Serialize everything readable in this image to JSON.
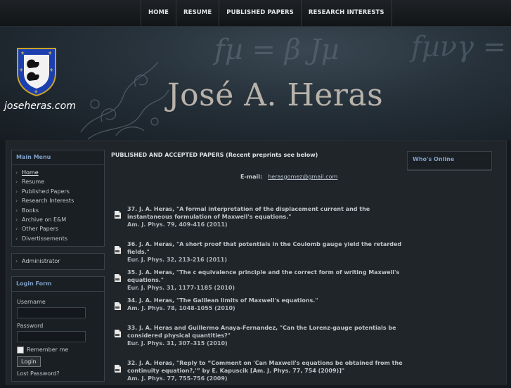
{
  "nav": [
    "HOME",
    "RESUME",
    "PUBLISHED PAPERS",
    "RESEARCH INTERESTS"
  ],
  "header": {
    "equation1": "fµ = β Jµ",
    "equation2": "fµνγ = 0",
    "title": "José A. Heras",
    "site_name": "joseheras.com"
  },
  "main_menu": {
    "title": "Main Menu",
    "items": [
      "Home",
      "Resume",
      "Published Papers",
      "Research Interests",
      "Books",
      "Archive on E&M",
      "Other Papers",
      "Divertissements"
    ]
  },
  "admin_menu": {
    "items": [
      "Administrator"
    ]
  },
  "login": {
    "title": "Login Form",
    "username_label": "Username",
    "password_label": "Password",
    "remember_label": "Remember me",
    "login_button": "Login",
    "lost_password": "Lost Password?"
  },
  "whos_online": {
    "title": "Who's Online"
  },
  "content": {
    "heading": "PUBLISHED AND ACCEPTED PAPERS (Recent preprints see below)",
    "email_label": "E-mail:",
    "email": "herasgomez@gmail.com",
    "papers": [
      {
        "text": "37. J. A. Heras, \"A formal interpretation of the displacement current and the instantaneous formulation of Maxwell's equations.\"",
        "ref": "Am. J. Phys. 79, 409-416 (2011)"
      },
      {
        "text": "36. J. A. Heras, \"A short proof that potentials in the Coulomb gauge yield the retarded fields.\"",
        "ref": "Eur. J. Phys. 32, 213-216 (2011)"
      },
      {
        "text": "35. J. A. Heras, \"The c equivalence principle and the correct form of writing Maxwell's equations.\"",
        "ref": "Eur. J. Phys. 31, 1177-1185 (2010)"
      },
      {
        "text": "34. J. A. Heras, \"The Galilean limits of Maxwell's equations.\"",
        "ref": "Am. J. Phys. 78, 1048-1055 (2010)"
      },
      {
        "text": "33. J. A. Heras and Guillermo Anaya-Fernandez, \"Can the Lorenz-gauge potentials be considered physical quantities?\"",
        "ref": "Eur. J. Phys. 31, 307–315 (2010)"
      },
      {
        "text": "32. J. A. Heras, \"Reply to “Comment on 'Can Maxwell's equations be obtained from the continuity equation?,'” by E. Kapuscik [Am. J. Phys. 77, 754 (2009)]\"",
        "ref": "Am. J. Phys. 77, 755-756 (2009)"
      }
    ]
  }
}
